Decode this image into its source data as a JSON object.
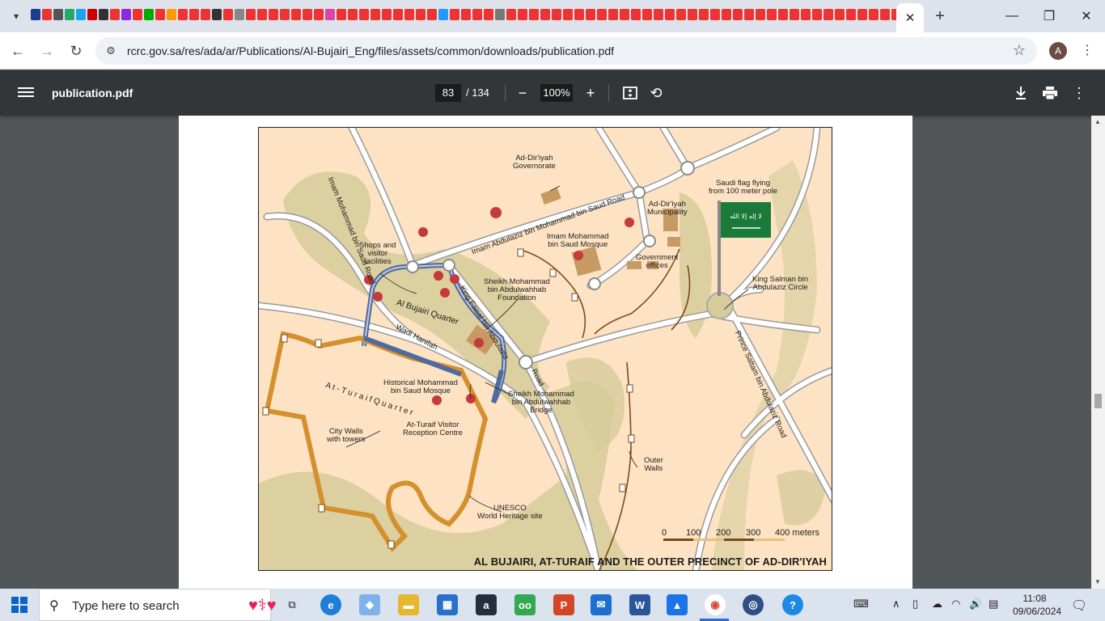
{
  "browser": {
    "tab_close": "✕",
    "new_tab": "+",
    "url": "rcrc.gov.sa/res/ada/ar/Publications/Al-Bujairi_Eng/files/assets/common/downloads/publication.pdf",
    "profile_initial": "A"
  },
  "pdf_toolbar": {
    "title": "publication.pdf",
    "current_page": "83",
    "page_count": "/ 134",
    "zoom": "100%"
  },
  "map": {
    "title": "AL BUJAIRI, AT-TURAIF AND THE OUTER PRECINCT OF AD-DIR'IYAH",
    "labels": {
      "governorate": "Ad-Dir'iyah\nGovernorate",
      "flag": "Saudi flag flying\nfrom 100 meter pole",
      "municipality": "Ad-Dir'iyah\nMunicipality",
      "mosque_imam": "Imam Mohammad\nbin Saud Mosque",
      "gov_offices": "Government\noffices",
      "shops": "Shops and\nvisitor\nfacilities",
      "foundation": "Sheikh Mohammad\nbin Abdulwahhab\nFoundation",
      "king_salman": "King Salman bin\nAbdulaziz Circle",
      "historical_mosque": "Historical Mohammad\nbin Saud Mosque",
      "bridge": "Sheikh Mohammad\nbin Abdulwahhab\nBridge",
      "reception": "At-Turaif Visitor\nReception Centre",
      "city_walls": "City Walls\nwith towers",
      "outer_walls": "Outer\nWalls",
      "unesco": "UNESCO\nWorld Heritage site",
      "road_imam_saud": "Imam Mohammad bin Saud Road",
      "road_abdulaziz": "Imam Abdulaziz bin Mohammad bin Saud Road",
      "road_king_faisal": "King Faisal bin Abdulaziz",
      "road_word": "Road",
      "road_prince_sattam": "Prince Sattam bin Abdulaziz Road",
      "al_bujairi": "Al Bujairi Quarter",
      "wadi": "Wadi Hanifah",
      "at_turaif": "A t - T u r a i f   Q u a r t e r"
    },
    "scale": [
      "0",
      "100",
      "200",
      "300",
      "400 meters"
    ],
    "flag_text": "لا إله إلا الله"
  },
  "taskbar": {
    "search_placeholder": "Type here to search",
    "time": "11:08",
    "date": "09/06/2024"
  },
  "colors": {
    "tabstrip": "#dee3eb",
    "pdf_toolbar": "#323639",
    "map_background": "#fde3c3",
    "wall": "#d4902c",
    "road_blue": "#4e6a9e",
    "green": "#c7b98a"
  }
}
